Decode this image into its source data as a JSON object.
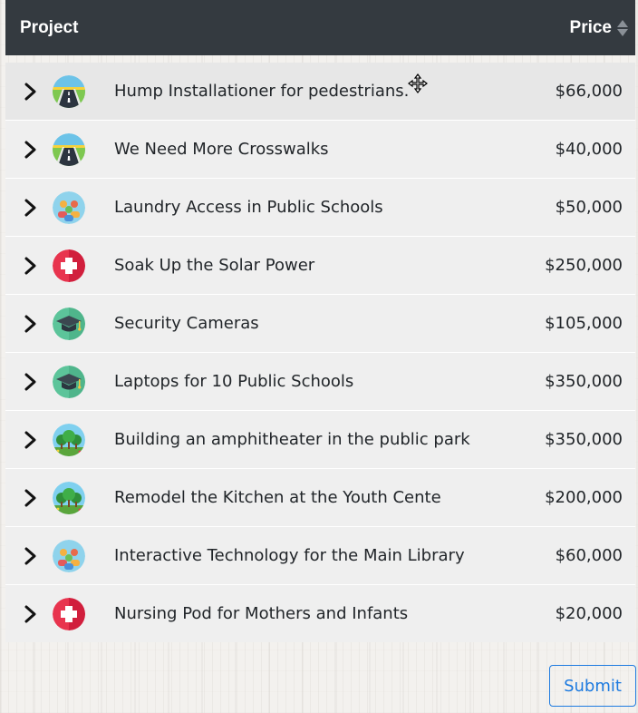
{
  "header": {
    "project_label": "Project",
    "price_label": "Price",
    "sort_icon": "sort-icon"
  },
  "rows": [
    {
      "title": "Hump Installationer for pedestrians.",
      "price": "$66,000",
      "icon": "road-icon"
    },
    {
      "title": "We Need More Crosswalks",
      "price": "$40,000",
      "icon": "road-icon"
    },
    {
      "title": "Laundry Access in Public Schools",
      "price": "$50,000",
      "icon": "people-icon"
    },
    {
      "title": "Soak Up the Solar Power",
      "price": "$250,000",
      "icon": "health-cross-icon"
    },
    {
      "title": "Security Cameras",
      "price": "$105,000",
      "icon": "graduation-cap-icon"
    },
    {
      "title": "Laptops for 10 Public Schools",
      "price": "$350,000",
      "icon": "graduation-cap-icon"
    },
    {
      "title": "Building an amphitheater in the public park",
      "price": "$350,000",
      "icon": "park-trees-icon"
    },
    {
      "title": "Remodel the Kitchen at the Youth Cente",
      "price": "$200,000",
      "icon": "park-trees-icon"
    },
    {
      "title": "Interactive Technology for the Main Library",
      "price": "$60,000",
      "icon": "people-icon"
    },
    {
      "title": "Nursing Pod for Mothers and Infants",
      "price": "$20,000",
      "icon": "health-cross-icon"
    }
  ],
  "submit_label": "Submit",
  "colors": {
    "header_bg": "#343a40",
    "accent": "#1e7be0",
    "row_bg": "#efefef"
  }
}
